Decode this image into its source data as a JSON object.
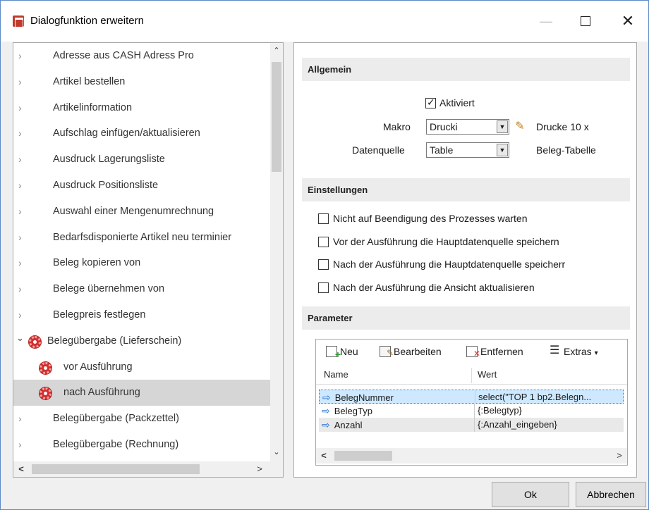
{
  "window": {
    "title": "Dialogfunktion erweitern",
    "minimize": "—",
    "close": "✕"
  },
  "tree": {
    "items": [
      {
        "label": "Adresse aus CASH Adress Pro",
        "type": "collapsed"
      },
      {
        "label": "Artikel bestellen",
        "type": "collapsed"
      },
      {
        "label": "Artikelinformation",
        "type": "collapsed"
      },
      {
        "label": "Aufschlag einfügen/aktualisieren",
        "type": "collapsed"
      },
      {
        "label": "Ausdruck Lagerungsliste",
        "type": "collapsed"
      },
      {
        "label": "Ausdruck Positionsliste",
        "type": "collapsed"
      },
      {
        "label": "Auswahl einer Mengenumrechnung",
        "type": "collapsed"
      },
      {
        "label": "Bedarfsdisponierte Artikel neu terminier",
        "type": "collapsed"
      },
      {
        "label": "Beleg kopieren von",
        "type": "collapsed"
      },
      {
        "label": "Belege übernehmen von",
        "type": "collapsed"
      },
      {
        "label": "Belegpreis festlegen",
        "type": "collapsed"
      },
      {
        "label": "Belegübergabe (Lieferschein)",
        "type": "expanded"
      },
      {
        "label": "vor Ausführung",
        "type": "child"
      },
      {
        "label": "nach Ausführung",
        "type": "child-selected"
      },
      {
        "label": "Belegübergabe (Packzettel)",
        "type": "collapsed"
      },
      {
        "label": "Belegübergabe (Rechnung)",
        "type": "collapsed"
      }
    ],
    "chevron_right": "›",
    "chevron_down": "⌄",
    "scroll_up": "⌃",
    "scroll_down": "⌄",
    "scroll_left": "<",
    "scroll_right": ">"
  },
  "allgemein": {
    "heading": "Allgemein",
    "aktiviert_label": "Aktiviert",
    "aktiviert_checked": true,
    "makro_label": "Makro",
    "makro_value": "Drucki",
    "makro_note": "Drucke 10 x",
    "datenquelle_label": "Datenquelle",
    "datenquelle_value": "Table",
    "datenquelle_note": "Beleg-Tabelle",
    "dropdown_glyph": "▼"
  },
  "einstellungen": {
    "heading": "Einstellungen",
    "options": [
      {
        "label": "Nicht auf Beendigung des Prozesses warten",
        "checked": false
      },
      {
        "label": "Vor der Ausführung die Hauptdatenquelle speichern",
        "checked": false
      },
      {
        "label": "Nach der Ausführung die Hauptdatenquelle speicherr",
        "checked": false
      },
      {
        "label": "Nach der Ausführung die Ansicht aktualisieren",
        "checked": false
      }
    ]
  },
  "parameter": {
    "heading": "Parameter",
    "toolbar": {
      "neu": "Neu",
      "bearbeiten": "Bearbeiten",
      "entfernen": "Entfernen",
      "extras": "Extras",
      "extras_arrow": "▾"
    },
    "columns": [
      "Name",
      "Wert"
    ],
    "rows": [
      {
        "name": "BelegNummer",
        "wert": "select(\"TOP 1  bp2.Belegn..."
      },
      {
        "name": "BelegTyp",
        "wert": "{:Belegtyp}"
      },
      {
        "name": "Anzahl",
        "wert": "{:Anzahl_eingeben}"
      }
    ],
    "arrow_glyph": "⇨",
    "scroll_left": "<",
    "scroll_right": ">"
  },
  "buttons": {
    "ok": "Ok",
    "cancel": "Abbrechen"
  }
}
